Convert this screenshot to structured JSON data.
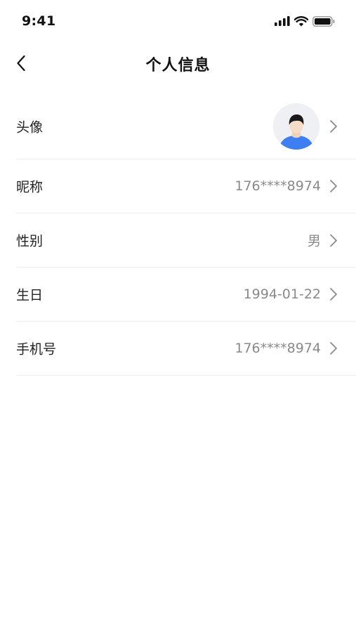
{
  "status_bar": {
    "time": "9:41",
    "icons": [
      "signal-icon",
      "wifi-icon",
      "battery-icon"
    ]
  },
  "nav": {
    "title": "个人信息",
    "back_icon": "chevron-left-icon"
  },
  "rows": [
    {
      "label": "头像",
      "value": "",
      "type": "avatar"
    },
    {
      "label": "昵称",
      "value": "176****8974"
    },
    {
      "label": "性别",
      "value": "男"
    },
    {
      "label": "生日",
      "value": "1994-01-22"
    },
    {
      "label": "手机号",
      "value": "176****8974"
    }
  ],
  "colors": {
    "avatar_shirt": "#3d7ef0",
    "avatar_bg": "#eef0f4",
    "value_text": "#8a8a8a",
    "divider": "#efefef"
  }
}
